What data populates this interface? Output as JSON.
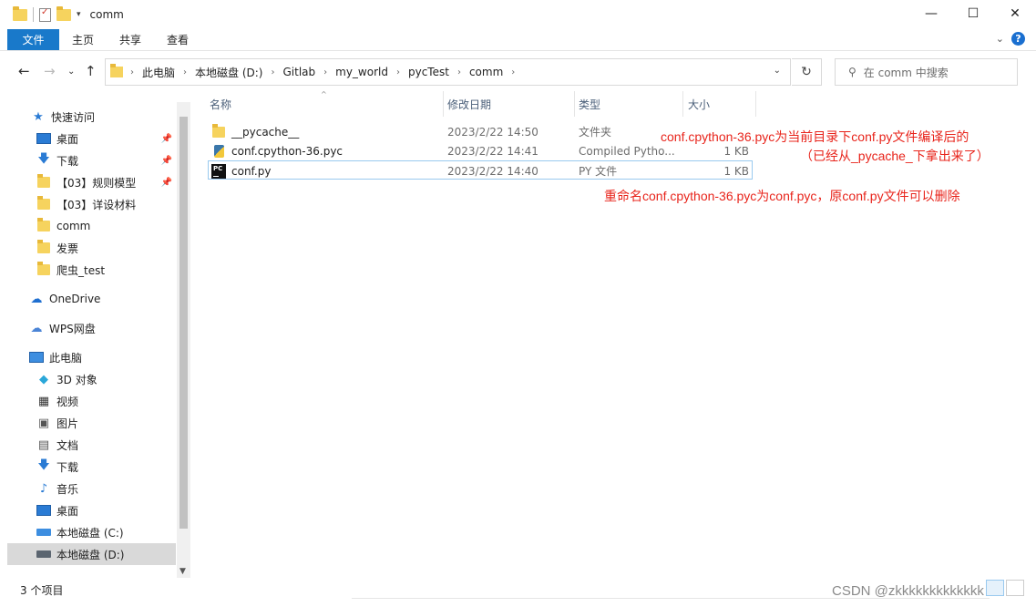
{
  "window": {
    "title": "comm",
    "controls": {
      "minimize": "—",
      "maximize": "☐",
      "close": "✕"
    }
  },
  "ribbon": {
    "tabs": [
      "文件",
      "主页",
      "共享",
      "查看"
    ],
    "help": "?"
  },
  "nav": {
    "breadcrumbs": [
      "此电脑",
      "本地磁盘 (D:)",
      "Gitlab",
      "my_world",
      "pycTest",
      "comm"
    ],
    "search_placeholder": "在 comm 中搜索"
  },
  "sidebar": {
    "items": [
      {
        "label": "快速访问",
        "icon": "star-icon",
        "pinned": false
      },
      {
        "label": "桌面",
        "icon": "desktop-icon",
        "pinned": true
      },
      {
        "label": "下载",
        "icon": "download-icon",
        "pinned": true
      },
      {
        "label": "【03】规则模型",
        "icon": "folder-icon",
        "pinned": true
      },
      {
        "label": "【03】详设材料",
        "icon": "folder-icon",
        "pinned": false
      },
      {
        "label": "comm",
        "icon": "folder-icon",
        "pinned": false
      },
      {
        "label": "发票",
        "icon": "folder-icon",
        "pinned": false
      },
      {
        "label": "爬虫_test",
        "icon": "folder-icon",
        "pinned": false
      },
      {
        "label": "OneDrive",
        "icon": "cloud-icon",
        "pinned": false
      },
      {
        "label": "WPS网盘",
        "icon": "wps-cloud-icon",
        "pinned": false
      },
      {
        "label": "此电脑",
        "icon": "computer-icon",
        "pinned": false
      },
      {
        "label": "3D 对象",
        "icon": "cube-icon",
        "pinned": false
      },
      {
        "label": "视频",
        "icon": "video-icon",
        "pinned": false
      },
      {
        "label": "图片",
        "icon": "picture-icon",
        "pinned": false
      },
      {
        "label": "文档",
        "icon": "document-icon",
        "pinned": false
      },
      {
        "label": "下载",
        "icon": "download-icon",
        "pinned": false
      },
      {
        "label": "音乐",
        "icon": "music-icon",
        "pinned": false
      },
      {
        "label": "桌面",
        "icon": "desktop-icon",
        "pinned": false
      },
      {
        "label": "本地磁盘 (C:)",
        "icon": "drive-icon",
        "pinned": false
      },
      {
        "label": "本地磁盘 (D:)",
        "icon": "drive-icon",
        "pinned": false,
        "selected": true
      }
    ]
  },
  "columns": {
    "name": "名称",
    "date": "修改日期",
    "type": "类型",
    "size": "大小"
  },
  "files": [
    {
      "name": "__pycache__",
      "date": "2023/2/22 14:50",
      "type": "文件夹",
      "size": "",
      "icon": "folder-icon"
    },
    {
      "name": "conf.cpython-36.pyc",
      "date": "2023/2/22 14:41",
      "type": "Compiled Pytho...",
      "size": "1 KB",
      "icon": "python-compiled-icon"
    },
    {
      "name": "conf.py",
      "date": "2023/2/22 14:40",
      "type": "PY 文件",
      "size": "1 KB",
      "icon": "pycharm-icon"
    }
  ],
  "annotations": {
    "line1": "conf.cpython-36.pyc为当前目录下conf.py文件编译后的",
    "line2": "（已经从_pycache_下拿出来了）",
    "line3": "重命名conf.cpython-36.pyc为conf.pyc，原conf.py文件可以删除"
  },
  "status": {
    "count": "3 个项目"
  },
  "watermark": "CSDN @zkkkkkkkkkkkkk",
  "colors": {
    "accent": "#1979ca",
    "annotation": "#e8241b",
    "folder": "#f6d35e"
  }
}
